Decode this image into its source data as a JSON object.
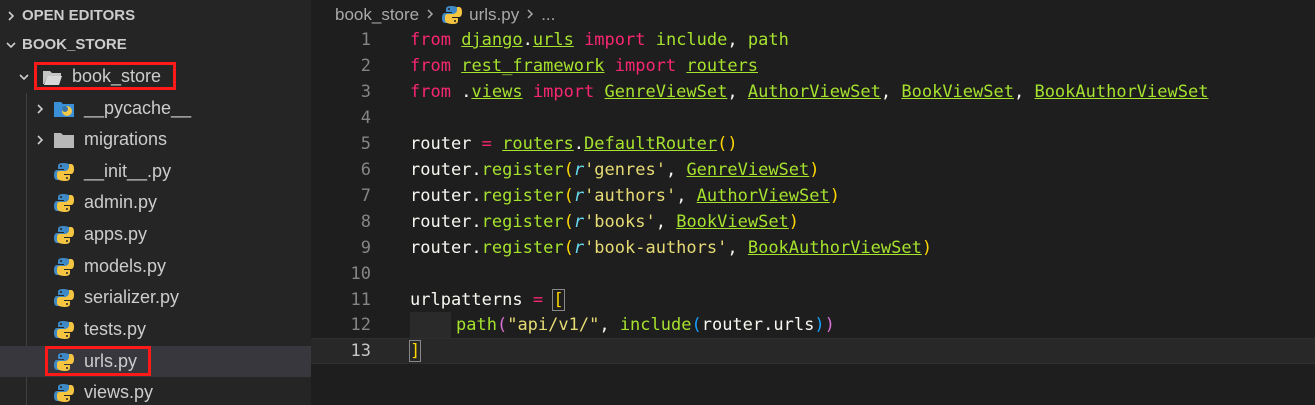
{
  "explorer": {
    "open_editors": "OPEN EDITORS",
    "project": "BOOK_STORE",
    "folder": "book_store",
    "items": [
      {
        "label": "__pycache__",
        "type": "folder",
        "icon": "python-folder-icon"
      },
      {
        "label": "migrations",
        "type": "folder",
        "icon": "folder-icon"
      },
      {
        "label": "__init__.py",
        "type": "file",
        "icon": "python-file-icon"
      },
      {
        "label": "admin.py",
        "type": "file",
        "icon": "python-file-icon"
      },
      {
        "label": "apps.py",
        "type": "file",
        "icon": "python-file-icon"
      },
      {
        "label": "models.py",
        "type": "file",
        "icon": "python-file-icon"
      },
      {
        "label": "serializer.py",
        "type": "file",
        "icon": "python-file-icon"
      },
      {
        "label": "tests.py",
        "type": "file",
        "icon": "python-file-icon"
      },
      {
        "label": "urls.py",
        "type": "file",
        "icon": "python-file-icon",
        "selected": true
      },
      {
        "label": "views.py",
        "type": "file",
        "icon": "python-file-icon"
      }
    ]
  },
  "breadcrumb": {
    "folder": "book_store",
    "file": "urls.py",
    "ellipsis": "..."
  },
  "editor": {
    "line_numbers": [
      "1",
      "2",
      "3",
      "4",
      "5",
      "6",
      "7",
      "8",
      "9",
      "10",
      "11",
      "12",
      "13"
    ],
    "active_line": "13",
    "lines": {
      "l1": {
        "kw1": "from",
        "mod1": "django",
        "dot": ".",
        "mod2": "urls",
        "kw2": " import ",
        "fn1": "include",
        "c": ", ",
        "fn2": "path"
      },
      "l2": {
        "kw1": "from",
        "mod1": "rest_framework",
        "kw2": " import ",
        "mod2": "routers"
      },
      "l3": {
        "kw1": "from",
        "dot": " .",
        "mod1": "views",
        "kw2": " import ",
        "c1": "GenreViewSet",
        "s1": ", ",
        "c2": "AuthorViewSet",
        "s2": ", ",
        "c3": "BookViewSet",
        "s3": ", ",
        "c4": "BookAuthorViewSet"
      },
      "l5": {
        "v": "router",
        "eq": " = ",
        "mod": "routers",
        "dot": ".",
        "cls": "DefaultRouter",
        "open": "(",
        "close": ")"
      },
      "l6": {
        "v": "router",
        "dot": ".",
        "fn": "register",
        "open": "(",
        "r": "r",
        "s": "'genres'",
        "c": ", ",
        "cls": "GenreViewSet",
        "close": ")"
      },
      "l7": {
        "v": "router",
        "dot": ".",
        "fn": "register",
        "open": "(",
        "r": "r",
        "s": "'authors'",
        "c": ", ",
        "cls": "AuthorViewSet",
        "close": ")"
      },
      "l8": {
        "v": "router",
        "dot": ".",
        "fn": "register",
        "open": "(",
        "r": "r",
        "s": "'books'",
        "c": ", ",
        "cls": "BookViewSet",
        "close": ")"
      },
      "l9": {
        "v": "router",
        "dot": ".",
        "fn": "register",
        "open": "(",
        "r": "r",
        "s": "'book-authors'",
        "c": ", ",
        "cls": "BookAuthorViewSet",
        "close": ")"
      },
      "l11": {
        "v": "urlpatterns",
        "eq": " = ",
        "open": "["
      },
      "l12": {
        "fn1": "path",
        "open1": "(",
        "s": "\"api/v1/\"",
        "c": ", ",
        "fn2": "include",
        "open2": "(",
        "arg": "router.urls",
        "close2": ")",
        "close1": ")"
      },
      "l13": {
        "close": "]"
      }
    }
  },
  "colors": {
    "highlight_box": "#ff1a1a",
    "keyword": "#f92672",
    "identifier": "#a6e22e",
    "string": "#e6db74"
  }
}
